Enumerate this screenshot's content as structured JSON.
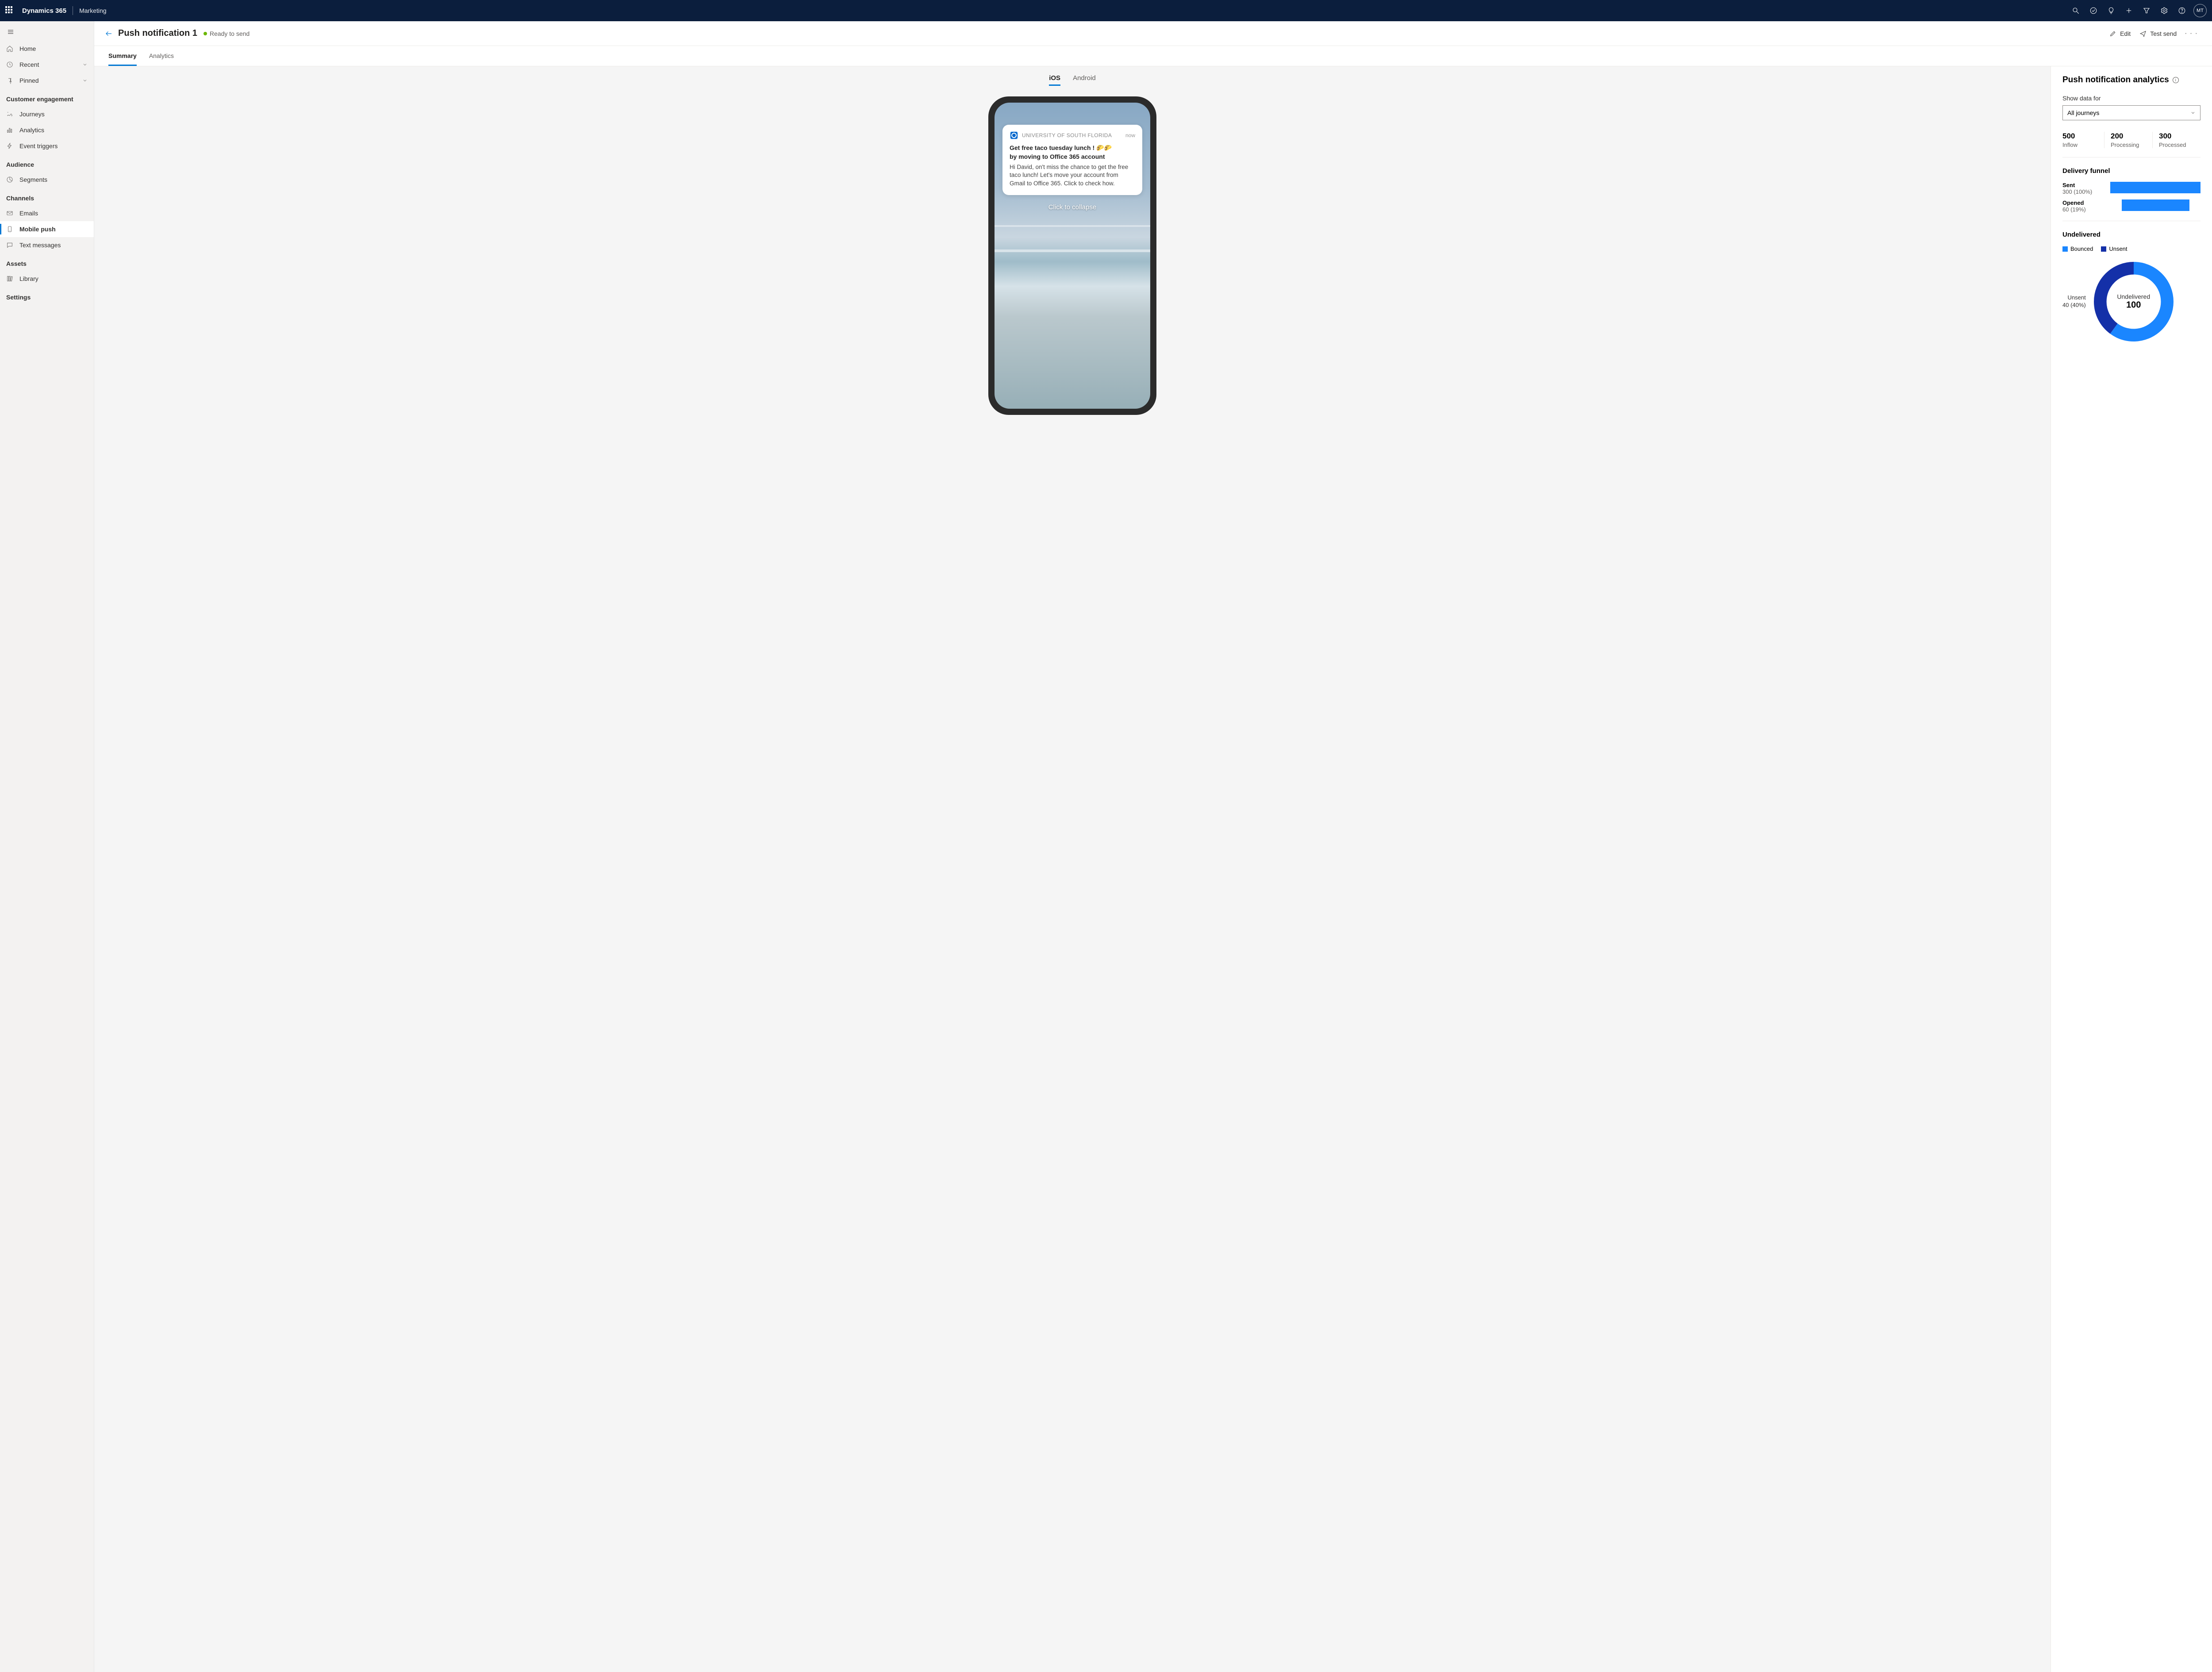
{
  "header": {
    "app_name": "Dynamics 365",
    "app_area": "Marketing",
    "avatar_initials": "MT"
  },
  "sidebar": {
    "top": [
      {
        "label": "Home"
      },
      {
        "label": "Recent",
        "expandable": true
      },
      {
        "label": "Pinned",
        "expandable": true
      }
    ],
    "sections": [
      {
        "title": "Customer engagement",
        "items": [
          {
            "label": "Journeys"
          },
          {
            "label": "Analytics"
          },
          {
            "label": "Event triggers"
          }
        ]
      },
      {
        "title": "Audience",
        "items": [
          {
            "label": "Segments"
          }
        ]
      },
      {
        "title": "Channels",
        "items": [
          {
            "label": "Emails"
          },
          {
            "label": "Mobile push",
            "active": true
          },
          {
            "label": "Text messages"
          }
        ]
      },
      {
        "title": "Assets",
        "items": [
          {
            "label": "Library"
          }
        ]
      },
      {
        "title": "Settings",
        "items": []
      }
    ]
  },
  "page": {
    "title": "Push notification 1",
    "status": "Ready to send",
    "commands": {
      "edit": "Edit",
      "test_send": "Test send"
    },
    "tabs": {
      "summary": "Summary",
      "analytics": "Analytics"
    },
    "device_tabs": {
      "ios": "iOS",
      "android": "Android"
    }
  },
  "notification": {
    "app_name": "UNIVERSITY OF SOUTH FLORIDA",
    "time": "now",
    "title_line1": "Get free taco tuesday lunch ! 🌮🌮",
    "title_line2": "by moving to Office 365 account",
    "body": "Hi David, on't miss the chance to get the free taco lunch! Let's move your account from Gmail to Office 365. Click to check how.",
    "collapse": "Click to collapse"
  },
  "analytics_panel": {
    "title": "Push notification analytics",
    "filter_label": "Show data for",
    "filter_value": "All journeys",
    "stats": [
      {
        "value": "500",
        "label": "Inflow"
      },
      {
        "value": "200",
        "label": "Processing"
      },
      {
        "value": "300",
        "label": "Processed"
      }
    ],
    "funnel_title": "Delivery funnel",
    "funnel": [
      {
        "label": "Sent",
        "sub": "300 (100%)",
        "pct": 100
      },
      {
        "label": "Opened",
        "sub": "60 (19%)",
        "pct": 75
      }
    ],
    "undelivered_title": "Undelivered",
    "legend": [
      {
        "label": "Bounced",
        "color": "#1a86ff"
      },
      {
        "label": "Unsent",
        "color": "#1430a8"
      }
    ],
    "donut_side_label": "Unsent",
    "donut_side_sub": "40 (40%)",
    "donut_center_label": "Undelivered",
    "donut_center_value": "100"
  },
  "chart_data": {
    "stats": {
      "Inflow": 500,
      "Processing": 200,
      "Processed": 300
    },
    "funnel": {
      "type": "bar",
      "categories": [
        "Sent",
        "Opened"
      ],
      "values": [
        300,
        60
      ],
      "percents": [
        100,
        19
      ]
    },
    "undelivered_donut": {
      "type": "pie",
      "total_label": "Undelivered",
      "total": 100,
      "series": [
        {
          "name": "Unsent",
          "value": 40,
          "percent": 40,
          "color": "#1430a8"
        },
        {
          "name": "Bounced",
          "value": 60,
          "percent": 60,
          "color": "#1a86ff"
        }
      ]
    }
  }
}
